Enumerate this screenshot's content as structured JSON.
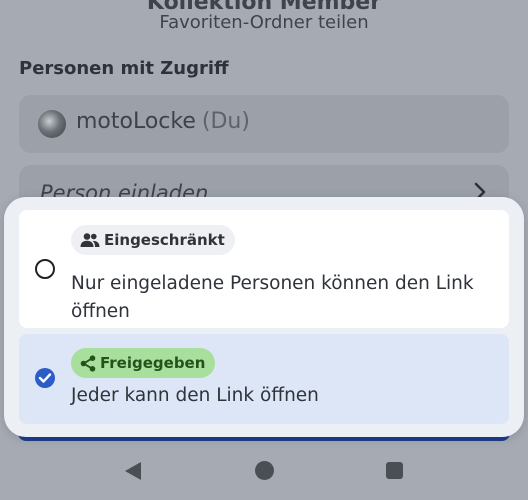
{
  "background": {
    "title": "Kollektion Member",
    "subtitle": "Favoriten-Ordner teilen",
    "section_title": "Personen mit Zugriff",
    "member": {
      "name": "motoLocke",
      "tag": "(Du)"
    },
    "invite_placeholder": "Person einladen"
  },
  "menu": {
    "options": [
      {
        "chip_label": "Eingeschränkt",
        "chip_icon": "group-icon",
        "description": "Nur eingeladene Personen können den Link öffnen",
        "selected": false
      },
      {
        "chip_label": "Freigegeben",
        "chip_icon": "share-icon",
        "description": "Jeder kann den Link öffnen",
        "selected": true
      }
    ]
  },
  "colors": {
    "accent": "#2c5cc7",
    "selected_bg": "#dce6f6",
    "shared_chip": "#a9df9c"
  },
  "navbar": {
    "icons": [
      "back-icon",
      "home-icon",
      "recents-icon"
    ]
  }
}
